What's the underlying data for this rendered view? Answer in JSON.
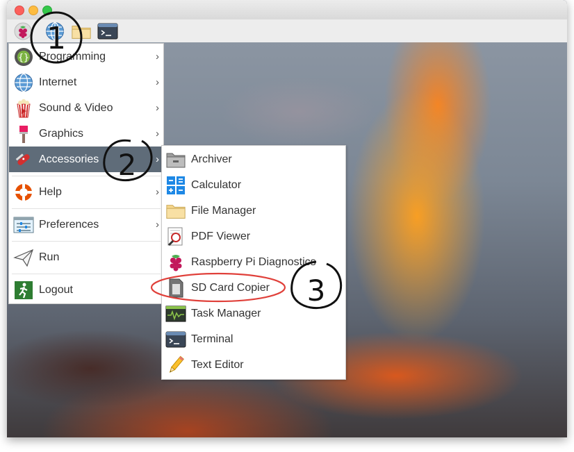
{
  "window": {
    "traffic_lights": [
      "close",
      "minimize",
      "maximize"
    ]
  },
  "panel": {
    "buttons": [
      {
        "name": "raspberry-menu-button",
        "icon": "raspberry-icon"
      },
      {
        "name": "web-browser-button",
        "icon": "globe-icon"
      },
      {
        "name": "file-manager-button",
        "icon": "folder-icon"
      },
      {
        "name": "terminal-button",
        "icon": "terminal-icon"
      }
    ]
  },
  "main_menu": {
    "items": [
      {
        "label": "Programming",
        "icon": "programming-icon",
        "submenu": true
      },
      {
        "label": "Internet",
        "icon": "globe-icon",
        "submenu": true
      },
      {
        "label": "Sound & Video",
        "icon": "popcorn-icon",
        "submenu": true
      },
      {
        "label": "Graphics",
        "icon": "paintbrush-icon",
        "submenu": true
      },
      {
        "label": "Accessories",
        "icon": "swiss-knife-icon",
        "submenu": true,
        "highlighted": true
      },
      {
        "label": "Help",
        "icon": "lifebuoy-icon",
        "submenu": true
      },
      {
        "label": "Preferences",
        "icon": "preferences-icon",
        "submenu": true
      },
      {
        "label": "Run",
        "icon": "paper-plane-icon",
        "submenu": false
      },
      {
        "label": "Logout",
        "icon": "exit-icon",
        "submenu": false
      }
    ],
    "arrow": "›"
  },
  "accessories_menu": {
    "items": [
      {
        "label": "Archiver",
        "icon": "archive-icon"
      },
      {
        "label": "Calculator",
        "icon": "calculator-icon"
      },
      {
        "label": "File Manager",
        "icon": "folder-icon"
      },
      {
        "label": "PDF Viewer",
        "icon": "magnifier-icon"
      },
      {
        "label": "Raspberry Pi Diagnostics",
        "icon": "raspberry-icon"
      },
      {
        "label": "SD Card Copier",
        "icon": "sd-card-icon",
        "circled": true
      },
      {
        "label": "Task Manager",
        "icon": "task-manager-icon"
      },
      {
        "label": "Terminal",
        "icon": "terminal-icon"
      },
      {
        "label": "Text Editor",
        "icon": "pencil-icon"
      }
    ]
  },
  "annotations": {
    "step1": "1",
    "step2": "2",
    "step3": "3",
    "circle_color": "#e0403a"
  },
  "colors": {
    "highlight": "#5f6c79",
    "menu_bg": "#ffffff"
  }
}
